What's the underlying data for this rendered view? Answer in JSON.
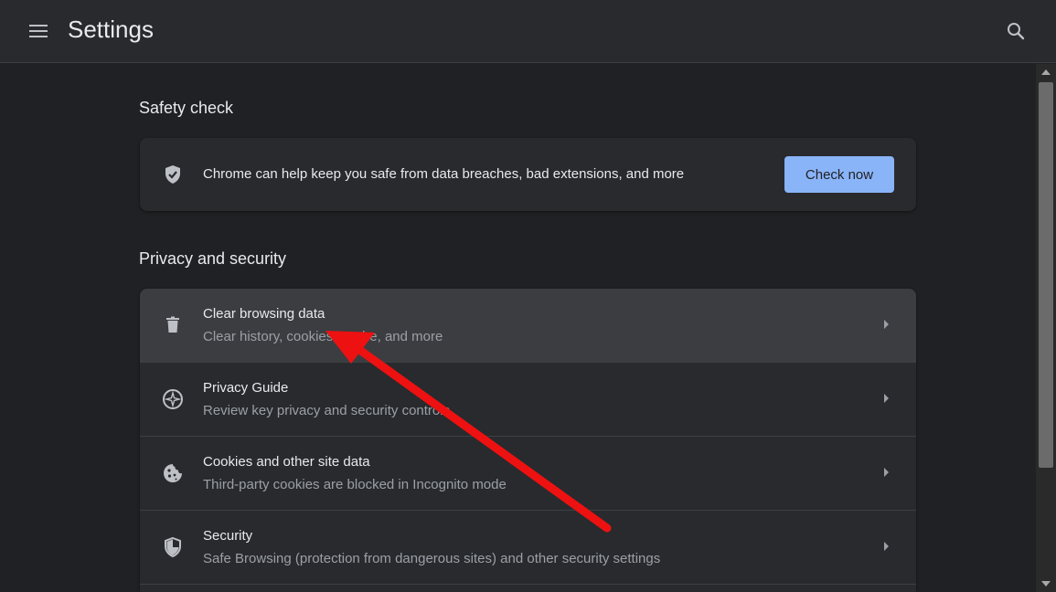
{
  "header": {
    "title": "Settings",
    "menu_icon": "hamburger-menu-icon",
    "search_icon": "search-icon"
  },
  "safety_check": {
    "heading": "Safety check",
    "icon": "shield-check-icon",
    "text": "Chrome can help keep you safe from data breaches, bad extensions, and more",
    "button_label": "Check now"
  },
  "privacy": {
    "heading": "Privacy and security",
    "items": [
      {
        "label": "Clear browsing data",
        "sub": "Clear history, cookies, cache, and more",
        "icon": "trash-icon",
        "highlighted": true
      },
      {
        "label": "Privacy Guide",
        "sub": "Review key privacy and security controls",
        "icon": "compass-icon"
      },
      {
        "label": "Cookies and other site data",
        "sub": "Third-party cookies are blocked in Incognito mode",
        "icon": "cookie-icon"
      },
      {
        "label": "Security",
        "sub": "Safe Browsing (protection from dangerous sites) and other security settings",
        "icon": "shield-icon"
      }
    ]
  },
  "colors": {
    "background": "#202124",
    "card": "#292a2d",
    "accent": "#8ab4f8",
    "annotation_arrow": "#ee1111"
  }
}
